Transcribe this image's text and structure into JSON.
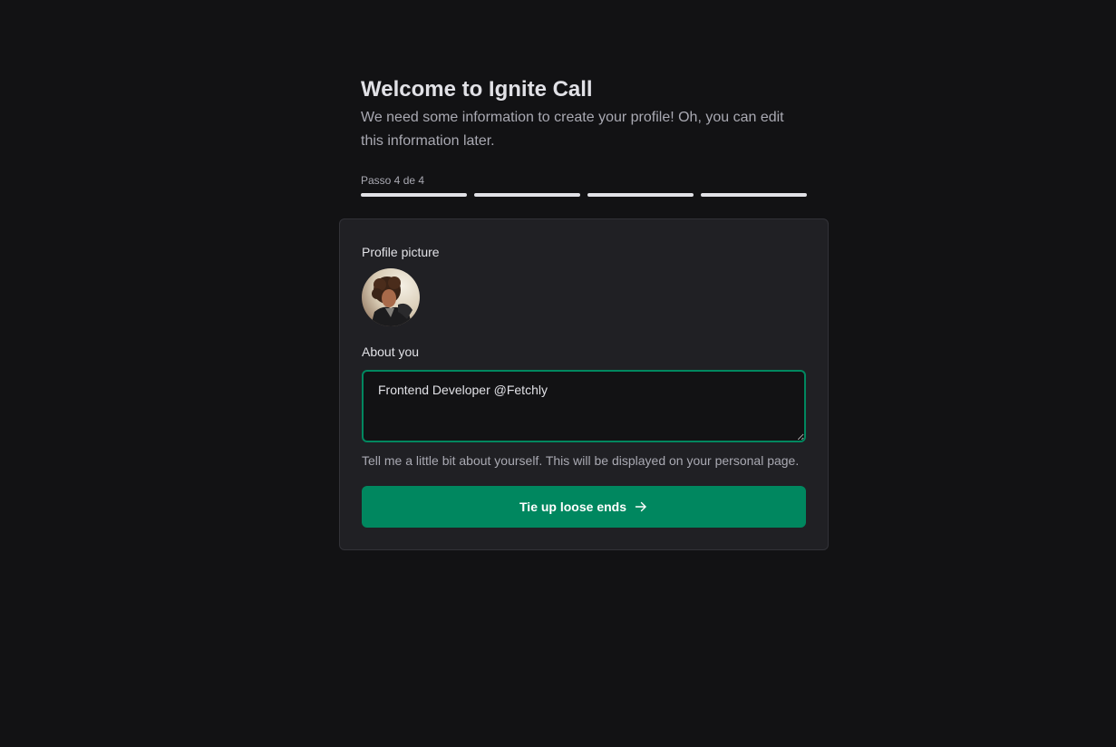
{
  "header": {
    "title": "Welcome to Ignite Call",
    "subtitle": "We need some information to create your profile! Oh, you can edit this information later.",
    "step_label": "Passo 4 de 4",
    "steps_total": 4,
    "steps_completed": 4
  },
  "form": {
    "profile_picture_label": "Profile picture",
    "about_label": "About you",
    "about_value": "Frontend Developer @Fetchly",
    "about_hint": "Tell me a little bit about yourself. This will be displayed on your personal page.",
    "submit_label": "Tie up loose ends",
    "submit_icon": "arrow-right-icon"
  },
  "colors": {
    "background": "#121214",
    "card": "#202024",
    "accent": "#00875f",
    "text": "#e1e1e6",
    "muted": "#a9a9b2"
  }
}
